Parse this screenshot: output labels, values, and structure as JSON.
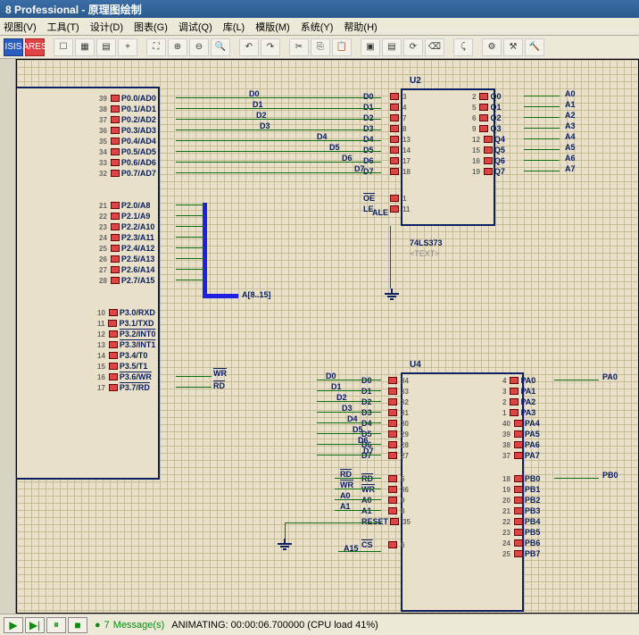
{
  "title": "8 Professional - 原理图绘制",
  "menu": {
    "view": "视图(V)",
    "tool": "工具(T)",
    "design": "设计(D)",
    "graph": "图表(G)",
    "debug": "调试(Q)",
    "lib": "库(L)",
    "tpl": "模版(M)",
    "sys": "系统(Y)",
    "help": "帮助(H)"
  },
  "components": {
    "cpu": {
      "p0": [
        {
          "name": "P0.0/AD0",
          "num": "39"
        },
        {
          "name": "P0.1/AD1",
          "num": "38"
        },
        {
          "name": "P0.2/AD2",
          "num": "37"
        },
        {
          "name": "P0.3/AD3",
          "num": "36"
        },
        {
          "name": "P0.4/AD4",
          "num": "35"
        },
        {
          "name": "P0.5/AD5",
          "num": "34"
        },
        {
          "name": "P0.6/AD6",
          "num": "33"
        },
        {
          "name": "P0.7/AD7",
          "num": "32"
        }
      ],
      "p2": [
        {
          "name": "P2.0/A8",
          "num": "21"
        },
        {
          "name": "P2.1/A9",
          "num": "22"
        },
        {
          "name": "P2.2/A10",
          "num": "23"
        },
        {
          "name": "P2.3/A11",
          "num": "24"
        },
        {
          "name": "P2.4/A12",
          "num": "25"
        },
        {
          "name": "P2.5/A13",
          "num": "26"
        },
        {
          "name": "P2.6/A14",
          "num": "27"
        },
        {
          "name": "P2.7/A15",
          "num": "28"
        }
      ],
      "p3": [
        {
          "name": "P3.0/RXD",
          "num": "10"
        },
        {
          "name": "P3.1/TXD",
          "num": "11"
        },
        {
          "name": "P3.2/INT0",
          "num": "12",
          "bar": true
        },
        {
          "name": "P3.3/INT1",
          "num": "13",
          "bar": true
        },
        {
          "name": "P3.4/T0",
          "num": "14"
        },
        {
          "name": "P3.5/T1",
          "num": "15"
        },
        {
          "name": "P3.6/WR",
          "num": "16",
          "bar": true
        },
        {
          "name": "P3.7/RD",
          "num": "17",
          "bar": true
        }
      ]
    },
    "u2": {
      "ref": "U2",
      "part": "74LS373",
      "text": "<TEXT>",
      "left": [
        {
          "name": "D0",
          "num": "3"
        },
        {
          "name": "D1",
          "num": "4"
        },
        {
          "name": "D2",
          "num": "7"
        },
        {
          "name": "D3",
          "num": "8"
        },
        {
          "name": "D4",
          "num": "13"
        },
        {
          "name": "D5",
          "num": "14"
        },
        {
          "name": "D6",
          "num": "17"
        },
        {
          "name": "D7",
          "num": "18"
        },
        {
          "name": "OE",
          "num": "1",
          "bar": true,
          "gap": true
        },
        {
          "name": "LE",
          "num": "11"
        }
      ],
      "right": [
        {
          "name": "Q0",
          "num": "2"
        },
        {
          "name": "Q1",
          "num": "5"
        },
        {
          "name": "Q2",
          "num": "6"
        },
        {
          "name": "Q3",
          "num": "9"
        },
        {
          "name": "Q4",
          "num": "12"
        },
        {
          "name": "Q5",
          "num": "15"
        },
        {
          "name": "Q6",
          "num": "16"
        },
        {
          "name": "Q7",
          "num": "19"
        }
      ]
    },
    "u4": {
      "ref": "U4",
      "left": [
        {
          "name": "D0",
          "num": "34"
        },
        {
          "name": "D1",
          "num": "33"
        },
        {
          "name": "D2",
          "num": "32"
        },
        {
          "name": "D3",
          "num": "31"
        },
        {
          "name": "D4",
          "num": "30"
        },
        {
          "name": "D5",
          "num": "29"
        },
        {
          "name": "D6",
          "num": "28"
        },
        {
          "name": "D7",
          "num": "27"
        },
        {
          "name": "RD",
          "num": "5",
          "bar": true,
          "gap": true
        },
        {
          "name": "WR",
          "num": "36",
          "bar": true
        },
        {
          "name": "A0",
          "num": "9"
        },
        {
          "name": "A1",
          "num": "8"
        },
        {
          "name": "RESET",
          "num": "35"
        },
        {
          "name": "CS",
          "num": "6",
          "bar": true,
          "gap": true
        }
      ],
      "right": [
        {
          "name": "PA0",
          "num": "4"
        },
        {
          "name": "PA1",
          "num": "3"
        },
        {
          "name": "PA2",
          "num": "2"
        },
        {
          "name": "PA3",
          "num": "1"
        },
        {
          "name": "PA4",
          "num": "40"
        },
        {
          "name": "PA5",
          "num": "39"
        },
        {
          "name": "PA6",
          "num": "38"
        },
        {
          "name": "PA7",
          "num": "37"
        },
        {
          "name": "PB0",
          "num": "18",
          "gap": true
        },
        {
          "name": "PB1",
          "num": "19"
        },
        {
          "name": "PB2",
          "num": "20"
        },
        {
          "name": "PB3",
          "num": "21"
        },
        {
          "name": "PB4",
          "num": "22"
        },
        {
          "name": "PB5",
          "num": "23"
        },
        {
          "name": "PB6",
          "num": "24"
        },
        {
          "name": "PB7",
          "num": "25"
        }
      ]
    }
  },
  "netlabels": {
    "d": [
      "D0",
      "D1",
      "D2",
      "D3",
      "D4",
      "D5",
      "D6",
      "D7"
    ],
    "a": [
      "A0",
      "A1",
      "A2",
      "A3",
      "A4",
      "A5",
      "A6",
      "A7"
    ],
    "bus": "A[8..15]",
    "ale": "ALE",
    "wr": "WR",
    "rd": "RD",
    "u4d": [
      "D0",
      "D1",
      "D2",
      "D3",
      "D4",
      "D5",
      "D6",
      "D7"
    ],
    "u4ctl": [
      "RD",
      "WR",
      "A0",
      "A1"
    ],
    "u4cs": "A15",
    "pa0": "PA0",
    "pb0": "PB0"
  },
  "status": {
    "messages_count": "7",
    "messages_label": "Message(s)",
    "anim": "ANIMATING: 00:00:06.700000 (CPU load 41%)"
  }
}
